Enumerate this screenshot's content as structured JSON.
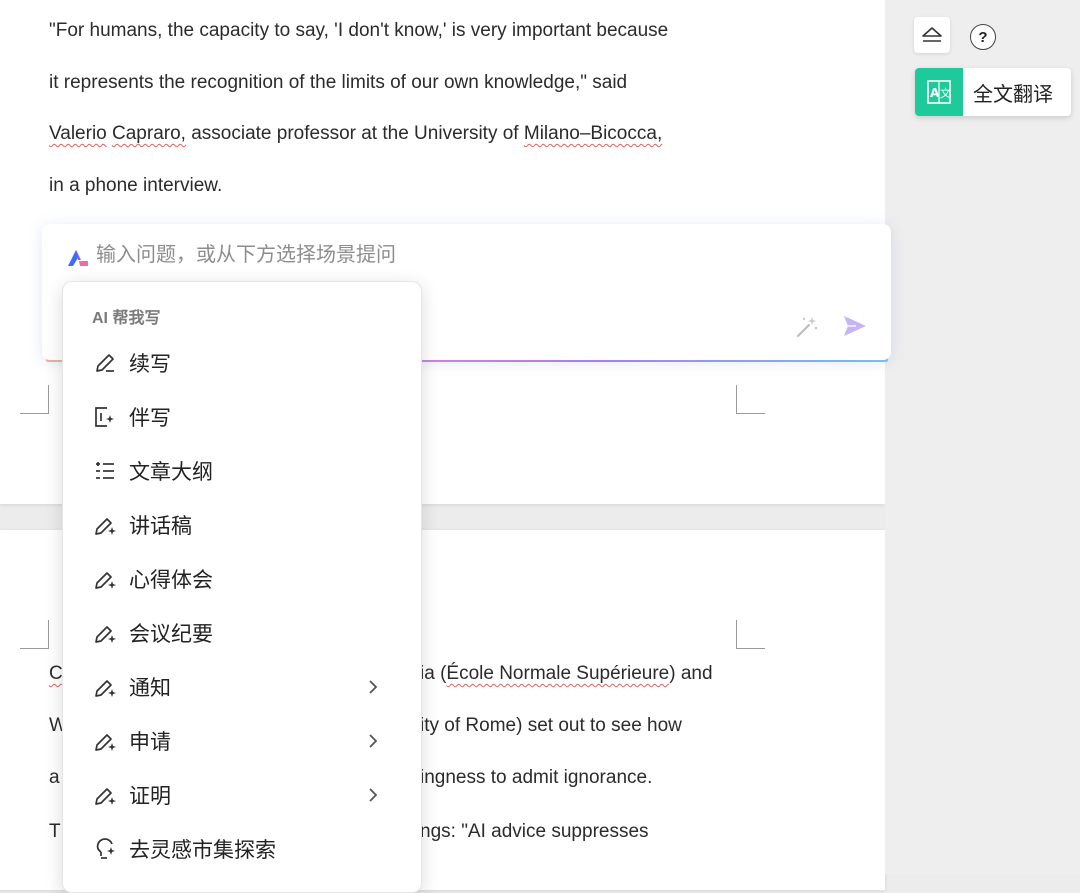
{
  "document": {
    "page1_lines": [
      "\"For humans, the capacity to say, 'I don't know,' is very important because",
      "it represents the recognition of the limits of our own knowledge,\" said",
      "associate professor at the University of",
      "in a phone interview."
    ],
    "name_first": "Valerio",
    "name_last": "Capraro,",
    "university_name": "Milano–Bicocca,",
    "page2_lines": [
      {
        "lead": "C",
        "tail_prefix": "ia (",
        "tail_squiggle": "École Normale Supérieure",
        "tail_suffix": ") and"
      },
      {
        "lead": "W",
        "tail": "ity of Rome) set out to see how"
      },
      {
        "lead": "a",
        "tail": "ingness to admit ignorance."
      },
      {
        "lead": "T",
        "tail": "ngs: \"AI advice suppresses"
      }
    ]
  },
  "ai_prompt": {
    "placeholder": "输入问题，或从下方选择场景提问"
  },
  "ai_menu": {
    "header": "AI 帮我写",
    "items": [
      {
        "label": "续写",
        "icon": "pen-icon"
      },
      {
        "label": "伴写",
        "icon": "cowrite-icon"
      },
      {
        "label": "文章大纲",
        "icon": "outline-icon"
      },
      {
        "label": "讲话稿",
        "icon": "pen-sparkle-icon"
      },
      {
        "label": "心得体会",
        "icon": "pen-sparkle-icon"
      },
      {
        "label": "会议纪要",
        "icon": "pen-sparkle-icon"
      },
      {
        "label": "通知",
        "icon": "pen-sparkle-icon",
        "submenu": true
      },
      {
        "label": "申请",
        "icon": "pen-sparkle-icon",
        "submenu": true
      },
      {
        "label": "证明",
        "icon": "pen-sparkle-icon",
        "submenu": true
      },
      {
        "label": "去灵感市集探索",
        "icon": "lightbulb-icon"
      }
    ]
  },
  "right_panel": {
    "help_label": "?",
    "translate_label": "全文翻译",
    "accent_color": "#1ec99a"
  }
}
